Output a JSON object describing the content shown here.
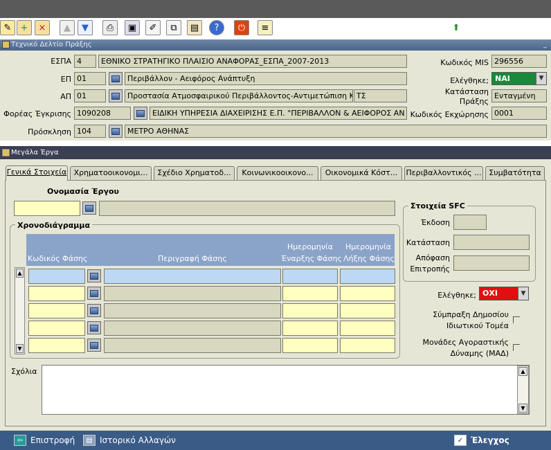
{
  "toolbar": {
    "icons": [
      "edit-icon",
      "add-record-icon",
      "delete-record-icon",
      "up-arrow-icon",
      "down-arrow-icon",
      "print-icon",
      "save-icon",
      "notes-icon",
      "copy-icon",
      "paste-icon",
      "help-icon",
      "exit-icon",
      "list-icon",
      "menu-icon"
    ]
  },
  "header_panel": {
    "title": "Τεχνικό Δελτίο Πράξης",
    "espa_label": "ΕΣΠΑ",
    "espa_code": "4",
    "espa_desc": "ΕΘΝΙΚΟ ΣΤΡΑΤΗΓΙΚΟ ΠΛΑΙΣΙΟ ΑΝΑΦΟΡΑΣ_ΕΣΠΑ_2007-2013",
    "ep_label": "ΕΠ",
    "ep_code": "01",
    "ep_desc": "Περιβάλλον - Αειφόρος Ανάπτυξη",
    "ap_label": "ΑΠ",
    "ap_code": "01",
    "ap_desc": "Προστασία Ατμοσφαιρικού Περιβάλλοντος-Αντιμετώπιση Κλιμ",
    "ap_extra": "ΤΣ",
    "foreas_label": "Φορέας Έγκρισης",
    "foreas_code": "1090208",
    "foreas_desc": "ΕΙΔΙΚΗ ΥΠΗΡΕΣΙΑ ΔΙΑΧΕΙΡΙΣΗΣ Ε.Π. \"ΠΕΡΙΒΑΛΛΟΝ & ΑΕΙΦΟΡΟΣ ΑΝ",
    "prosklisi_label": "Πρόσκληση",
    "prosklisi_code": "104",
    "prosklisi_desc": "ΜΕΤΡΟ ΑΘΗΝΑΣ",
    "mis_label": "Κωδικός MIS",
    "mis_value": "296556",
    "checked_label": "Ελέγθηκε;",
    "checked_value": "ΝΑΙ",
    "status_label_1": "Κατάσταση",
    "status_label_2": "Πράξης",
    "status_value": "Ενταγμένη",
    "ekxorisi_label": "Κωδικός Εκχώρησης",
    "ekxorisi_value": "0001"
  },
  "projects_panel": {
    "title": "Μεγάλα Έργα",
    "tabs": [
      "Γενικά Στοιχεία",
      "Χρηματοοικονομι...",
      "Σχέδιο Χρηματοδ...",
      "Κοινωνικοοικονο...",
      "Οικονομικά Κόστ...",
      "Περιβαλλοντικός ...",
      "Συμβατότητα"
    ],
    "name_label": "Ονομασία Έργου",
    "timeline_title": "Χρονοδιάγραμμα",
    "col_code": "Κωδικός Φάσης",
    "col_desc": "Περιγραφή Φάσης",
    "col_start_1": "Ημερομηνία",
    "col_start_2": "Έναρξης Φάσης",
    "col_end_1": "Ημερομηνία",
    "col_end_2": "Λήξης Φάσης",
    "sfc_title": "Στοιχεία SFC",
    "sfc_edition": "Έκδοση",
    "sfc_status": "Κατάσταση",
    "sfc_decision_1": "Απόφαση",
    "sfc_decision_2": "Επιτροπής",
    "checked_label": "Ελέγθηκε;",
    "checked_value": "ΟΧΙ",
    "ppp_label_1": "Σύμπραξη Δημοσίου",
    "ppp_label_2": "Ιδιωτικού Τομέα",
    "mad_label_1": "Μονάδες Αγοραστικής",
    "mad_label_2": "Δύναμης (ΜΑΔ)",
    "comments_label": "Σχόλια"
  },
  "bottom_bar": {
    "back": "Επιστροφή",
    "history": "Ιστορικό Αλλαγών",
    "check": "Έλεγχος"
  },
  "colors": {
    "field_gray": "#d8d8c0",
    "field_yellow": "#ffffc0",
    "field_blue": "#bcd8f5",
    "yes_green": "#1a8a3a",
    "no_red": "#e01010",
    "panel_bg": "#e6e6d6"
  }
}
